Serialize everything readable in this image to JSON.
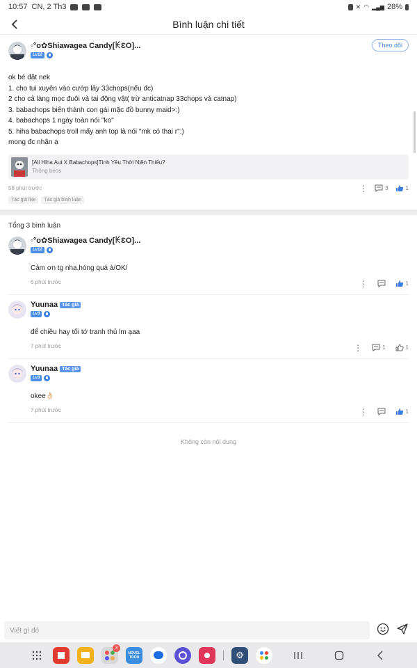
{
  "status_bar": {
    "time": "10:57",
    "date": "CN, 2 Th3",
    "battery": "28%"
  },
  "header": {
    "title": "Bình luận chi tiết"
  },
  "post": {
    "username": "◦°o✿Shiawagea Candy[ꀘƐO]...",
    "level": "Lv12",
    "follow_label": "Theo dõi",
    "lines": [
      "ok bé đặt nek",
      "1. cho tui xuyên vào cướp lây 33chops(nếu đc)",
      "2 cho cả làng mọc đuôi và tai động vật( trừ anticatnap 33chops và catnap)",
      "3. babachops biến thành con gái mặc đồ bunny maid>:)",
      "4. babachops 1 ngày toàn nói \"ko\"",
      "5. hiha babachops troll mấy anh top là nói \"mk có thai r\":)",
      "mong đc nhận ạ"
    ],
    "linked": {
      "title": "[All Hiha Aut X Babachops]Tình Yêu Thời Niên Thiếu?",
      "subtitle": "Thông beos"
    },
    "time": "58 phút trước",
    "comment_count": "3",
    "like_count": "1",
    "tags": [
      "Tác giả like",
      "Tác giả bình luận"
    ]
  },
  "comments_section": {
    "total": "Tổng 3 bình luận",
    "items": [
      {
        "username": "◦°o✿Shiawagea Candy[ꀘƐO]...",
        "level": "Lv12",
        "author_tag": "",
        "text": "Cảm ơn tg nha,hóng quá à/OK/",
        "time": "6 phút trước",
        "comment_count": "",
        "like_count": "1"
      },
      {
        "username": "Yuunaa",
        "level": "Lv3",
        "author_tag": "Tác giả",
        "text": "để chiều hay tối tớ tranh thủ lm ạaa",
        "time": "7 phút trước",
        "comment_count": "1",
        "like_count": "1"
      },
      {
        "username": "Yuunaa",
        "level": "Lv3",
        "author_tag": "Tác giả",
        "text": "okee👌🏻",
        "time": "7 phút trước",
        "comment_count": "",
        "like_count": "1"
      }
    ],
    "no_more": "Không còn nội dung"
  },
  "input": {
    "placeholder": "Viết gì đó"
  },
  "dock": {
    "badge_count": "3",
    "app_label": "NOVEL TOON"
  },
  "colors": {
    "accent": "#4a86d8",
    "liked": "#3b7fe0"
  }
}
